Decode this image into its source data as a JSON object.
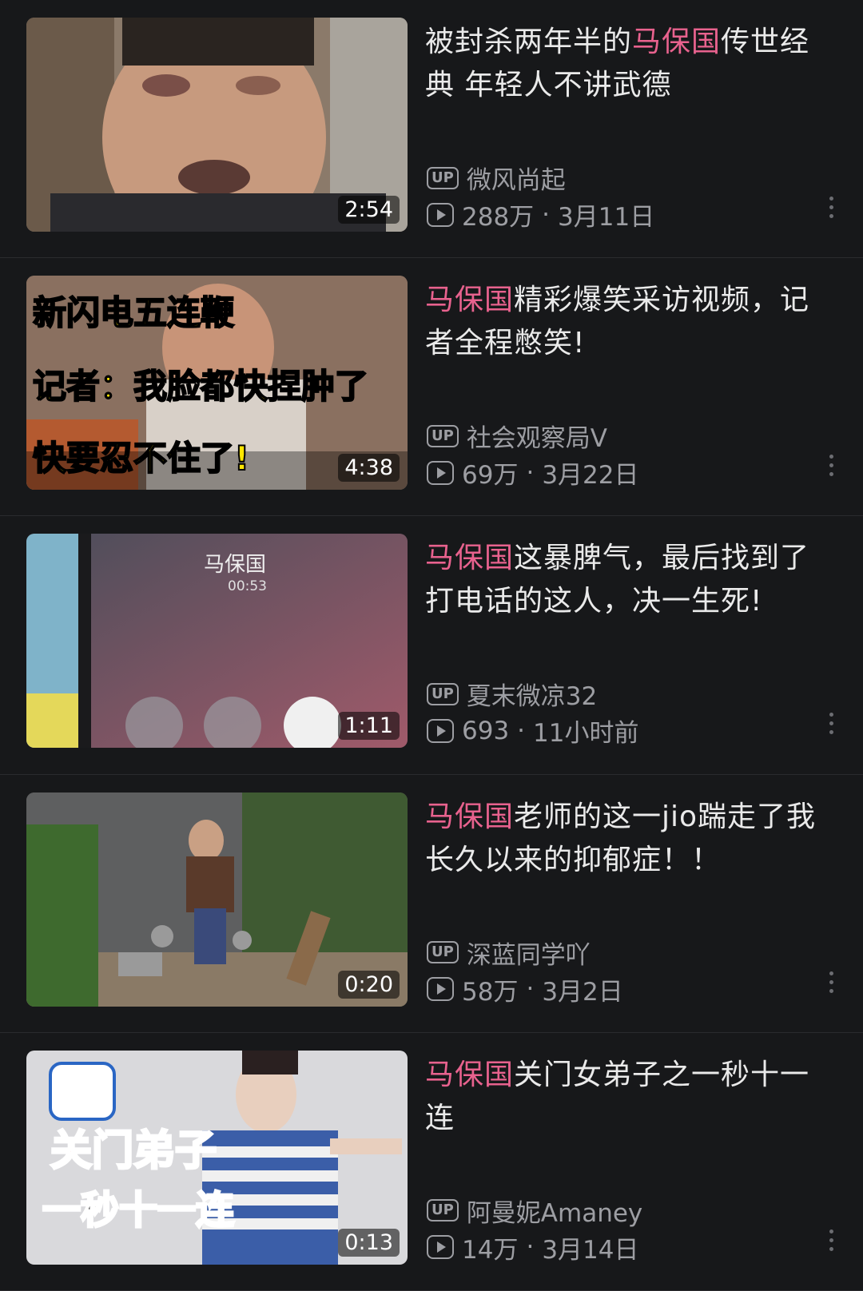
{
  "colors": {
    "background": "#17181a",
    "highlight": "#e8628e",
    "meta": "#9d9ea3"
  },
  "items": [
    {
      "title_pre": "被封杀两年半的",
      "title_hl": "马保国",
      "title_post": "传世经典 年轻人不讲武德",
      "duration": "2:54",
      "uploader": "微风尚起",
      "views": "288万",
      "date": "3月11日",
      "thumb_caption_lines": []
    },
    {
      "title_pre": "",
      "title_hl": "马保国",
      "title_post": "精彩爆笑采访视频，记者全程憋笑!",
      "duration": "4:38",
      "uploader": "社会观察局V",
      "views": "69万",
      "date": "3月22日",
      "thumb_caption_lines": [
        "新闪电五连鞭",
        "记者：我脸都快捏肿了",
        "快要忍不住了!"
      ]
    },
    {
      "title_pre": "",
      "title_hl": "马保国",
      "title_post": "这暴脾气，最后找到了打电话的这人，决一生死!",
      "duration": "1:11",
      "uploader": "夏末微凉32",
      "views": "693",
      "date": "11小时前",
      "thumb_caption_lines": [
        "马保国",
        "00:53"
      ]
    },
    {
      "title_pre": "",
      "title_hl": "马保国",
      "title_post": "老师的这一jio踹走了我长久以来的抑郁症！！",
      "duration": "0:20",
      "uploader": "深蓝同学吖",
      "views": "58万",
      "date": "3月2日",
      "thumb_caption_lines": []
    },
    {
      "title_pre": "",
      "title_hl": "马保国",
      "title_post": "关门女弟子之一秒十一连",
      "duration": "0:13",
      "uploader": "阿曼妮Amaney",
      "views": "14万",
      "date": "3月14日",
      "thumb_caption_lines": [
        "关门弟子",
        "一秒十一连"
      ]
    }
  ],
  "labels": {
    "up_badge": "UP",
    "dot": "·"
  }
}
